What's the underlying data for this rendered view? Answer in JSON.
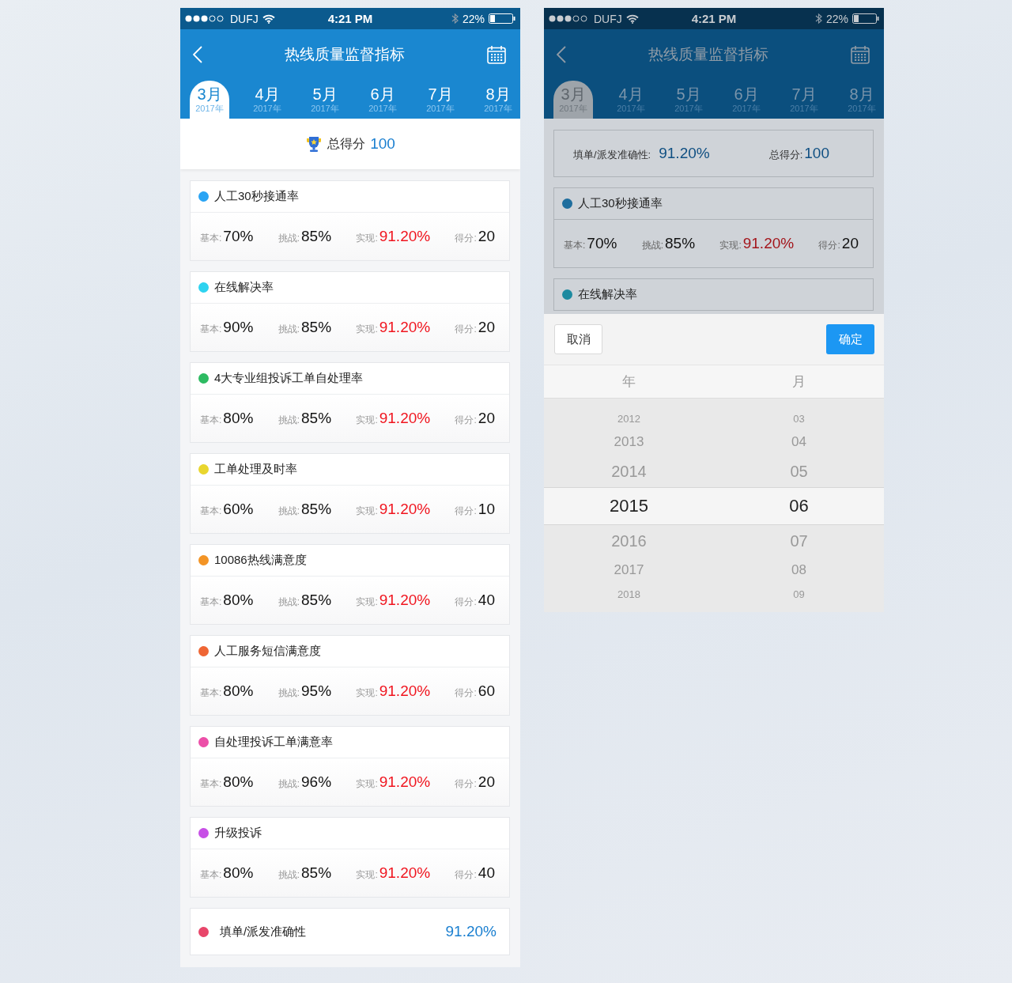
{
  "main_screen": {
    "dimmed": false,
    "status_bar": {
      "carrier": "DUFJ",
      "time": "4:21 PM",
      "battery": "22%"
    },
    "title": "热线质量监督指标",
    "tabs": [
      {
        "month": "3月",
        "year": "2017年",
        "selected": true
      },
      {
        "month": "4月",
        "year": "2017年",
        "selected": false
      },
      {
        "month": "5月",
        "year": "2017年",
        "selected": false
      },
      {
        "month": "6月",
        "year": "2017年",
        "selected": false
      },
      {
        "month": "7月",
        "year": "2017年",
        "selected": false
      },
      {
        "month": "8月",
        "year": "2017年",
        "selected": false
      }
    ],
    "total": {
      "label": "总得分",
      "value": "100"
    },
    "metrics": [
      {
        "kind": "metric",
        "name": "人工30秒接通率",
        "color": "#2aa4f4",
        "base_label": "基本:",
        "base": "70%",
        "challenge_label": "挑战:",
        "challenge": "85%",
        "actual_label": "实现:",
        "actual": "91.20%",
        "score_label": "得分:",
        "score": "20"
      },
      {
        "kind": "metric",
        "name": "在线解决率",
        "color": "#2ed3f0",
        "base_label": "基本:",
        "base": "90%",
        "challenge_label": "挑战:",
        "challenge": "85%",
        "actual_label": "实现:",
        "actual": "91.20%",
        "score_label": "得分:",
        "score": "20"
      },
      {
        "kind": "metric",
        "name": "4大专业组投诉工单自处理率",
        "color": "#2dbb62",
        "base_label": "基本:",
        "base": "80%",
        "challenge_label": "挑战:",
        "challenge": "85%",
        "actual_label": "实现:",
        "actual": "91.20%",
        "score_label": "得分:",
        "score": "20"
      },
      {
        "kind": "metric",
        "name": "工单处理及时率",
        "color": "#e9d62e",
        "base_label": "基本:",
        "base": "60%",
        "challenge_label": "挑战:",
        "challenge": "85%",
        "actual_label": "实现:",
        "actual": "91.20%",
        "score_label": "得分:",
        "score": "10"
      },
      {
        "kind": "metric",
        "name": "10086热线满意度",
        "color": "#f39425",
        "base_label": "基本:",
        "base": "80%",
        "challenge_label": "挑战:",
        "challenge": "85%",
        "actual_label": "实现:",
        "actual": "91.20%",
        "score_label": "得分:",
        "score": "40"
      },
      {
        "kind": "metric",
        "name": "人工服务短信满意度",
        "color": "#ef6634",
        "base_label": "基本:",
        "base": "80%",
        "challenge_label": "挑战:",
        "challenge": "95%",
        "actual_label": "实现:",
        "actual": "91.20%",
        "score_label": "得分:",
        "score": "60"
      },
      {
        "kind": "metric",
        "name": "自处理投诉工单满意率",
        "color": "#ec4fa8",
        "base_label": "基本:",
        "base": "80%",
        "challenge_label": "挑战:",
        "challenge": "96%",
        "actual_label": "实现:",
        "actual": "91.20%",
        "score_label": "得分:",
        "score": "20"
      },
      {
        "kind": "metric",
        "name": "升级投诉",
        "color": "#c74fe6",
        "base_label": "基本:",
        "base": "80%",
        "challenge_label": "挑战:",
        "challenge": "85%",
        "actual_label": "实现:",
        "actual": "91.20%",
        "score_label": "得分:",
        "score": "40"
      },
      {
        "kind": "summary",
        "name": "填单/派发准确性",
        "color": "#e8466a",
        "value": "91.20%"
      }
    ]
  },
  "picker_screen": {
    "dimmed": true,
    "status_bar": {
      "carrier": "DUFJ",
      "time": "4:21 PM",
      "battery": "22%"
    },
    "title": "热线质量监督指标",
    "tabs": [
      {
        "month": "3月",
        "year": "2017年",
        "selected": true
      },
      {
        "month": "4月",
        "year": "2017年",
        "selected": false
      },
      {
        "month": "5月",
        "year": "2017年",
        "selected": false
      },
      {
        "month": "6月",
        "year": "2017年",
        "selected": false
      },
      {
        "month": "7月",
        "year": "2017年",
        "selected": false
      },
      {
        "month": "8月",
        "year": "2017年",
        "selected": false
      }
    ],
    "overview": {
      "accuracy_label": "填单/派发准确性:",
      "accuracy": "91.20%",
      "total_label": "总得分:",
      "total": "100"
    },
    "metrics": [
      {
        "kind": "metric",
        "name": "人工30秒接通率",
        "color": "#1f6e9e",
        "base_label": "基本:",
        "base": "70%",
        "challenge_label": "挑战:",
        "challenge": "85%",
        "actual_label": "实现:",
        "actual": "91.20%",
        "score_label": "得分:",
        "score": "20"
      },
      {
        "kind": "title_only",
        "name": "在线解决率",
        "color": "#1d8aa0"
      }
    ],
    "picker": {
      "cancel": "取消",
      "confirm": "确定",
      "columns": [
        {
          "header": "年",
          "items": [
            {
              "label": "2012",
              "selected": false
            },
            {
              "label": "2013",
              "selected": false
            },
            {
              "label": "2014",
              "selected": false
            },
            {
              "label": "2015",
              "selected": true
            },
            {
              "label": "2016",
              "selected": false
            },
            {
              "label": "2017",
              "selected": false
            },
            {
              "label": "2018",
              "selected": false
            }
          ]
        },
        {
          "header": "月",
          "items": [
            {
              "label": "03",
              "selected": false
            },
            {
              "label": "04",
              "selected": false
            },
            {
              "label": "05",
              "selected": false
            },
            {
              "label": "06",
              "selected": true
            },
            {
              "label": "07",
              "selected": false
            },
            {
              "label": "08",
              "selected": false
            },
            {
              "label": "09",
              "selected": false
            }
          ]
        }
      ]
    }
  }
}
